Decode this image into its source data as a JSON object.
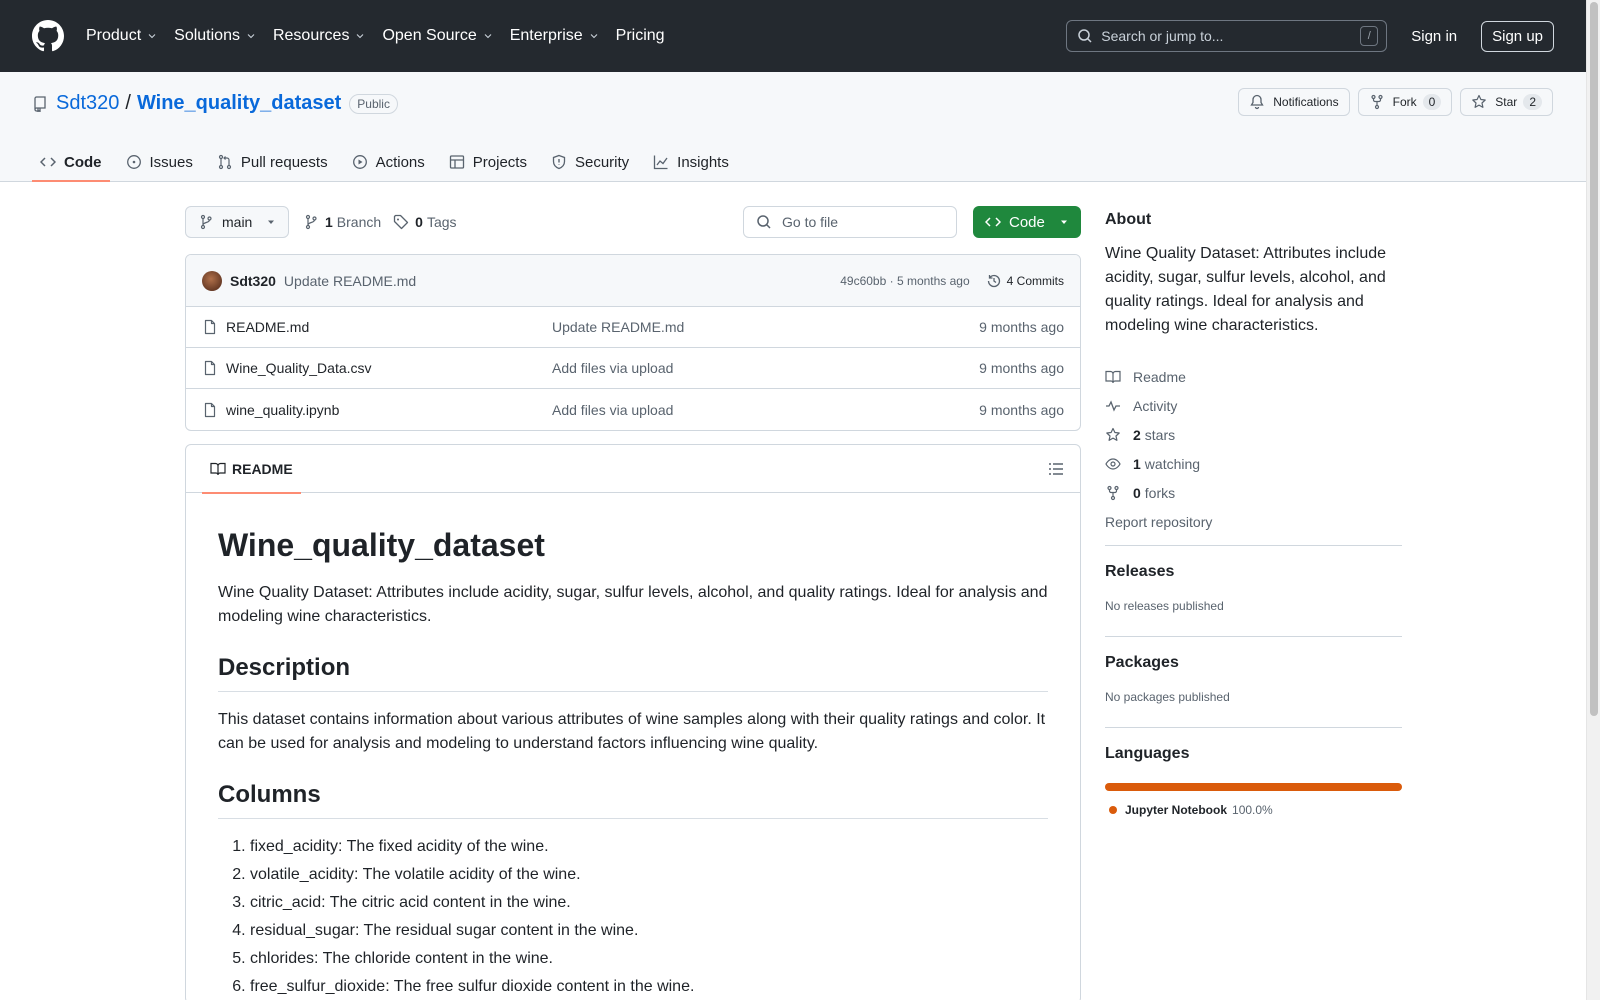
{
  "header": {
    "nav": [
      {
        "label": "Product",
        "has_menu": true
      },
      {
        "label": "Solutions",
        "has_menu": true
      },
      {
        "label": "Resources",
        "has_menu": true
      },
      {
        "label": "Open Source",
        "has_menu": true
      },
      {
        "label": "Enterprise",
        "has_menu": true
      },
      {
        "label": "Pricing",
        "has_menu": false
      }
    ],
    "search_placeholder": "Search or jump to...",
    "search_shortcut": "/",
    "sign_in": "Sign in",
    "sign_up": "Sign up"
  },
  "repo": {
    "owner": "Sdt320",
    "separator": "/",
    "name": "Wine_quality_dataset",
    "visibility": "Public",
    "notifications_label": "Notifications",
    "fork_label": "Fork",
    "fork_count": "0",
    "star_label": "Star",
    "star_count": "2"
  },
  "tabs": [
    {
      "label": "Code",
      "icon": "code-icon",
      "selected": true
    },
    {
      "label": "Issues",
      "icon": "issue-icon",
      "selected": false
    },
    {
      "label": "Pull requests",
      "icon": "pull-request-icon",
      "selected": false
    },
    {
      "label": "Actions",
      "icon": "play-icon",
      "selected": false
    },
    {
      "label": "Projects",
      "icon": "table-icon",
      "selected": false
    },
    {
      "label": "Security",
      "icon": "shield-icon",
      "selected": false
    },
    {
      "label": "Insights",
      "icon": "graph-icon",
      "selected": false
    }
  ],
  "toolbar": {
    "branch": "main",
    "branch_count": "1",
    "branch_label": "Branch",
    "tag_count": "0",
    "tag_label": "Tags",
    "go_to_file": "Go to file",
    "code_button": "Code"
  },
  "commit": {
    "author": "Sdt320",
    "message": "Update README.md",
    "meta": "49c60bb · 5 months ago",
    "count": "4 Commits"
  },
  "files": [
    {
      "name": "README.md",
      "message": "Update README.md",
      "time": "9 months ago"
    },
    {
      "name": "Wine_Quality_Data.csv",
      "message": "Add files via upload",
      "time": "9 months ago"
    },
    {
      "name": "wine_quality.ipynb",
      "message": "Add files via upload",
      "time": "9 months ago"
    }
  ],
  "readme": {
    "tab_label": "README",
    "title": "Wine_quality_dataset",
    "intro": "Wine Quality Dataset: Attributes include acidity, sugar, sulfur levels, alcohol, and quality ratings. Ideal for analysis and modeling wine characteristics.",
    "description_heading": "Description",
    "description": "This dataset contains information about various attributes of wine samples along with their quality ratings and color. It can be used for analysis and modeling to understand factors influencing wine quality.",
    "columns_heading": "Columns",
    "columns": [
      "fixed_acidity: The fixed acidity of the wine.",
      "volatile_acidity: The volatile acidity of the wine.",
      "citric_acid: The citric acid content in the wine.",
      "residual_sugar: The residual sugar content in the wine.",
      "chlorides: The chloride content in the wine.",
      "free_sulfur_dioxide: The free sulfur dioxide content in the wine."
    ]
  },
  "sidebar": {
    "about_heading": "About",
    "about_text": "Wine Quality Dataset: Attributes include acidity, sugar, sulfur levels, alcohol, and quality ratings. Ideal for analysis and modeling wine characteristics.",
    "readme_link": "Readme",
    "activity_link": "Activity",
    "stars_count": "2",
    "stars_label": "stars",
    "watching_count": "1",
    "watching_label": "watching",
    "forks_count": "0",
    "forks_label": "forks",
    "report": "Report repository",
    "releases_heading": "Releases",
    "releases_text": "No releases published",
    "packages_heading": "Packages",
    "packages_text": "No packages published",
    "languages_heading": "Languages",
    "language_name": "Jupyter Notebook",
    "language_percent": "100.0%",
    "language_color": "#DA5B0B"
  }
}
